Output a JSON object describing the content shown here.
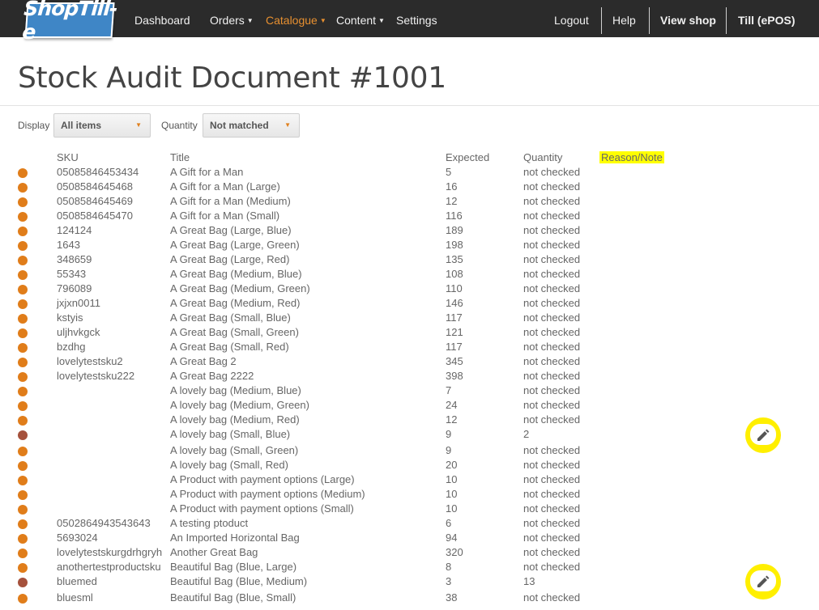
{
  "nav": {
    "logo": "ShopTill-e",
    "items": [
      {
        "label": "Dashboard",
        "dropdown": false
      },
      {
        "label": "Orders",
        "dropdown": true
      },
      {
        "label": "Catalogue",
        "dropdown": true
      },
      {
        "label": "Content",
        "dropdown": true
      },
      {
        "label": "Settings",
        "dropdown": false
      }
    ],
    "right": {
      "logout": "Logout",
      "help": "Help",
      "view_shop": "View shop",
      "till": "Till (ePOS)"
    },
    "active_color": "#e89030"
  },
  "page": {
    "title": "Stock Audit Document #1001"
  },
  "filters": {
    "display_label": "Display",
    "display_value": "All items",
    "quantity_label": "Quantity",
    "quantity_value": "Not matched"
  },
  "table": {
    "headers": {
      "sku": "SKU",
      "title": "Title",
      "expected": "Expected",
      "quantity": "Quantity",
      "reason": "Reason/Note"
    },
    "rows": [
      {
        "sku": "05085846453434",
        "title": "A Gift for a Man",
        "expected": "5",
        "quantity": "not checked",
        "status": "unchecked"
      },
      {
        "sku": "0508584645468",
        "title": "A Gift for a Man (Large)",
        "expected": "16",
        "quantity": "not checked",
        "status": "unchecked"
      },
      {
        "sku": "0508584645469",
        "title": "A Gift for a Man (Medium)",
        "expected": "12",
        "quantity": "not checked",
        "status": "unchecked"
      },
      {
        "sku": "0508584645470",
        "title": "A Gift for a Man (Small)",
        "expected": "116",
        "quantity": "not checked",
        "status": "unchecked"
      },
      {
        "sku": "124124",
        "title": "A Great Bag (Large, Blue)",
        "expected": "189",
        "quantity": "not checked",
        "status": "unchecked"
      },
      {
        "sku": "1643",
        "title": "A Great Bag (Large, Green)",
        "expected": "198",
        "quantity": "not checked",
        "status": "unchecked"
      },
      {
        "sku": "348659",
        "title": "A Great Bag (Large, Red)",
        "expected": "135",
        "quantity": "not checked",
        "status": "unchecked"
      },
      {
        "sku": "55343",
        "title": "A Great Bag (Medium, Blue)",
        "expected": "108",
        "quantity": "not checked",
        "status": "unchecked"
      },
      {
        "sku": "796089",
        "title": "A Great Bag (Medium, Green)",
        "expected": "110",
        "quantity": "not checked",
        "status": "unchecked"
      },
      {
        "sku": "jxjxn0011",
        "title": "A Great Bag (Medium, Red)",
        "expected": "146",
        "quantity": "not checked",
        "status": "unchecked"
      },
      {
        "sku": "kstyis",
        "title": "A Great Bag (Small, Blue)",
        "expected": "117",
        "quantity": "not checked",
        "status": "unchecked"
      },
      {
        "sku": "uljhvkgck",
        "title": "A Great Bag (Small, Green)",
        "expected": "121",
        "quantity": "not checked",
        "status": "unchecked"
      },
      {
        "sku": "bzdhg",
        "title": "A Great Bag (Small, Red)",
        "expected": "117",
        "quantity": "not checked",
        "status": "unchecked"
      },
      {
        "sku": "lovelytestsku2",
        "title": "A Great Bag 2",
        "expected": "345",
        "quantity": "not checked",
        "status": "unchecked"
      },
      {
        "sku": "lovelytestsku222",
        "title": "A Great Bag 2222",
        "expected": "398",
        "quantity": "not checked",
        "status": "unchecked"
      },
      {
        "sku": "",
        "title": "A lovely bag (Medium, Blue)",
        "expected": "7",
        "quantity": "not checked",
        "status": "unchecked"
      },
      {
        "sku": "",
        "title": "A lovely bag (Medium, Green)",
        "expected": "24",
        "quantity": "not checked",
        "status": "unchecked"
      },
      {
        "sku": "",
        "title": "A lovely bag (Medium, Red)",
        "expected": "12",
        "quantity": "not checked",
        "status": "unchecked"
      },
      {
        "sku": "",
        "title": "A lovely bag (Small, Blue)",
        "expected": "9",
        "quantity": "2",
        "status": "checked"
      },
      {
        "sku": "",
        "title": "A lovely bag (Small, Green)",
        "expected": "9",
        "quantity": "not checked",
        "status": "unchecked"
      },
      {
        "sku": "",
        "title": "A lovely bag (Small, Red)",
        "expected": "20",
        "quantity": "not checked",
        "status": "unchecked"
      },
      {
        "sku": "",
        "title": "A Product with payment options (Large)",
        "expected": "10",
        "quantity": "not checked",
        "status": "unchecked"
      },
      {
        "sku": "",
        "title": "A Product with payment options (Medium)",
        "expected": "10",
        "quantity": "not checked",
        "status": "unchecked"
      },
      {
        "sku": "",
        "title": "A Product with payment options (Small)",
        "expected": "10",
        "quantity": "not checked",
        "status": "unchecked"
      },
      {
        "sku": "0502864943543643",
        "title": "A testing ptoduct",
        "expected": "6",
        "quantity": "not checked",
        "status": "unchecked"
      },
      {
        "sku": "5693024",
        "title": "An Imported Horizontal Bag",
        "expected": "94",
        "quantity": "not checked",
        "status": "unchecked"
      },
      {
        "sku": "lovelytestskurgdrhgryh",
        "title": "Another Great Bag",
        "expected": "320",
        "quantity": "not checked",
        "status": "unchecked"
      },
      {
        "sku": "anothertestproductsku",
        "title": "Beautiful Bag (Blue, Large)",
        "expected": "8",
        "quantity": "not checked",
        "status": "unchecked"
      },
      {
        "sku": "bluemed",
        "title": "Beautiful Bag (Blue, Medium)",
        "expected": "3",
        "quantity": "13",
        "status": "checked"
      },
      {
        "sku": "bluesml",
        "title": "Beautiful Bag (Blue, Small)",
        "expected": "38",
        "quantity": "not checked",
        "status": "unchecked"
      }
    ],
    "colors": {
      "unchecked": "#e07d1a",
      "checked": "#a5513c",
      "highlight": "#ffff00"
    }
  },
  "icons": {
    "edit": "pencil-icon"
  }
}
